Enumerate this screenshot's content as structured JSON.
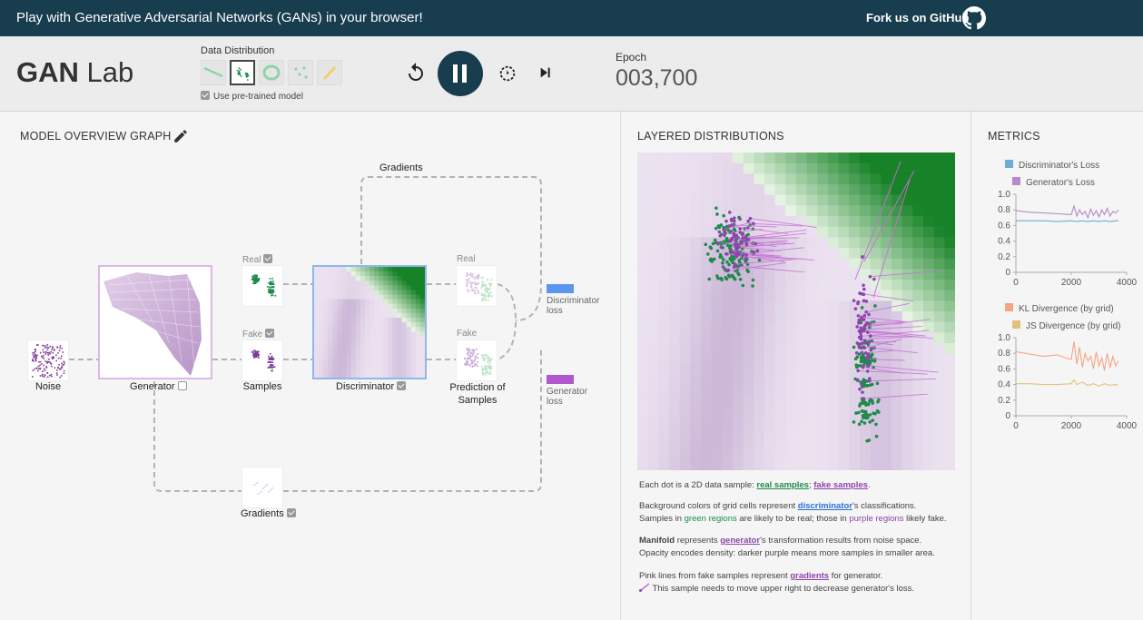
{
  "header": {
    "title": "Play with Generative Adversarial Networks (GANs) in your browser!",
    "fork": "Fork us on GitHub"
  },
  "controls": {
    "logo_bold": "GAN",
    "logo_rest": " Lab",
    "data_distribution_label": "Data Distribution",
    "pretrained_label": "Use pre-trained model",
    "epoch_label": "Epoch",
    "epoch_value": "003,700"
  },
  "model": {
    "title": "MODEL OVERVIEW GRAPH",
    "gradients_top": "Gradients",
    "noise": "Noise",
    "generator": "Generator",
    "real_small": "Real",
    "fake_small": "Fake",
    "samples": "Samples",
    "discriminator": "Discriminator",
    "pred_real": "Real",
    "pred_fake": "Fake",
    "prediction_l1": "Prediction of",
    "prediction_l2": "Samples",
    "disc_loss_l1": "Discriminator",
    "disc_loss_l2": "loss",
    "gen_loss_l1": "Generator",
    "gen_loss_l2": "loss",
    "gradients_bottom": "Gradients"
  },
  "layered": {
    "title": "LAYERED DISTRIBUTIONS",
    "d1a": "Each dot is a 2D data sample: ",
    "d1_real": "real samples",
    "d1_sep": "; ",
    "d1_fake": "fake samples",
    "d1_end": ".",
    "d2a": "Background colors of grid cells represent ",
    "d2_disc": "discriminator",
    "d2b": "'s classifications.",
    "d3a": "Samples in ",
    "d3_green": "green regions",
    "d3b": " are likely to be real; those in ",
    "d3_purple": "purple regions",
    "d3c": " likely fake.",
    "d4_bold": "Manifold",
    "d4a": " represents ",
    "d4_gen": "generator",
    "d4b": "'s transformation results from noise space.",
    "d5": "Opacity encodes density: darker purple means more samples in smaller area.",
    "d6a": "Pink lines from fake samples represent ",
    "d6_grad": "gradients",
    "d6b": " for generator.",
    "d7": "This sample needs to move upper right to decrease generator's loss."
  },
  "metrics": {
    "title": "METRICS",
    "colors": {
      "disc": "#6baed6",
      "gen": "#b38acb",
      "kl": "#f4a582",
      "js": "#e0c27c"
    }
  },
  "chart_data": [
    {
      "type": "line",
      "series": [
        {
          "name": "Discriminator's Loss",
          "x": [
            0,
            500,
            1000,
            1500,
            2000,
            2200,
            2400,
            2600,
            2800,
            3000,
            3200,
            3400,
            3600,
            3700
          ],
          "values": [
            0.66,
            0.66,
            0.66,
            0.65,
            0.66,
            0.65,
            0.66,
            0.65,
            0.66,
            0.65,
            0.66,
            0.65,
            0.66,
            0.66
          ]
        },
        {
          "name": "Generator's Loss",
          "x": [
            0,
            500,
            1000,
            1500,
            2000,
            2100,
            2200,
            2300,
            2400,
            2500,
            2600,
            2700,
            2800,
            2900,
            3000,
            3100,
            3200,
            3300,
            3400,
            3500,
            3600,
            3700
          ],
          "values": [
            0.79,
            0.77,
            0.76,
            0.75,
            0.74,
            0.85,
            0.72,
            0.8,
            0.74,
            0.78,
            0.7,
            0.81,
            0.73,
            0.79,
            0.71,
            0.8,
            0.74,
            0.82,
            0.72,
            0.78,
            0.76,
            0.8
          ]
        }
      ],
      "ylim": [
        0,
        1.0
      ],
      "xlim": [
        0,
        4000
      ],
      "yticks": [
        "1.0",
        "0.8",
        "0.6",
        "0.4",
        "0.2",
        "0"
      ],
      "xticks": [
        "0",
        "2000",
        "4000"
      ]
    },
    {
      "type": "line",
      "series": [
        {
          "name": "KL Divergence (by grid)",
          "x": [
            0,
            500,
            1000,
            1500,
            1800,
            2000,
            2100,
            2200,
            2300,
            2400,
            2500,
            2600,
            2700,
            2800,
            2900,
            3000,
            3100,
            3200,
            3300,
            3400,
            3500,
            3600,
            3700
          ],
          "values": [
            0.82,
            0.79,
            0.76,
            0.78,
            0.74,
            0.72,
            0.95,
            0.66,
            0.88,
            0.62,
            0.8,
            0.7,
            0.76,
            0.6,
            0.82,
            0.64,
            0.74,
            0.58,
            0.8,
            0.62,
            0.76,
            0.64,
            0.7
          ]
        },
        {
          "name": "JS Divergence (by grid)",
          "x": [
            0,
            500,
            1000,
            1500,
            2000,
            2100,
            2200,
            2400,
            2600,
            2800,
            3000,
            3200,
            3400,
            3600,
            3700
          ],
          "values": [
            0.41,
            0.41,
            0.4,
            0.4,
            0.41,
            0.46,
            0.4,
            0.43,
            0.39,
            0.41,
            0.38,
            0.41,
            0.39,
            0.4,
            0.39
          ]
        }
      ],
      "ylim": [
        0,
        1.0
      ],
      "xlim": [
        0,
        4000
      ],
      "yticks": [
        "1.0",
        "0.8",
        "0.6",
        "0.4",
        "0.2",
        "0"
      ],
      "xticks": [
        "0",
        "2000",
        "4000"
      ]
    }
  ]
}
